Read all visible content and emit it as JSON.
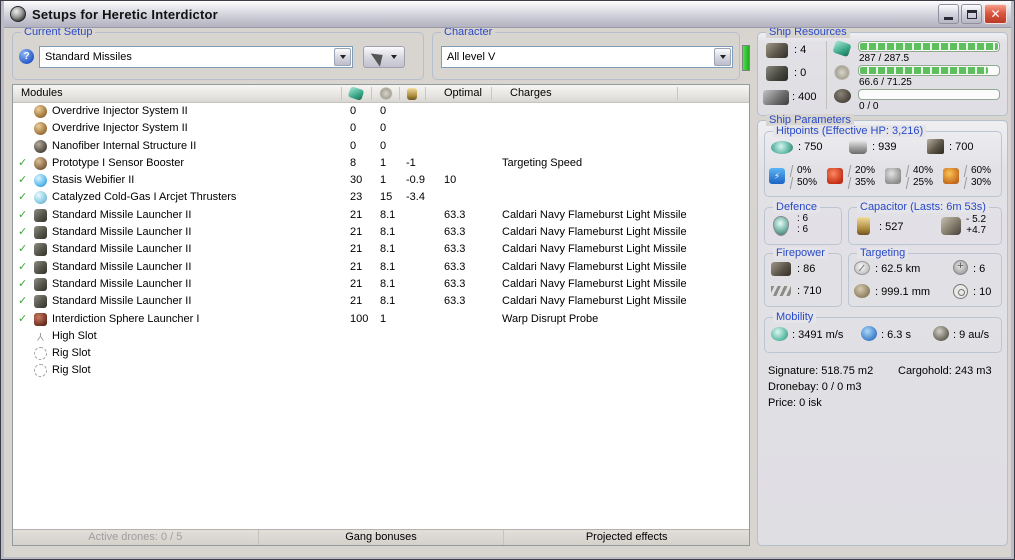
{
  "window": {
    "title": "Setups for Heretic Interdictor"
  },
  "current_setup": {
    "label": "Current Setup",
    "value": "Standard Missiles"
  },
  "character": {
    "label": "Character",
    "value": "All level V"
  },
  "ship_resources": {
    "label": "Ship Resources",
    "turrets": ": 4",
    "launchers": ": 0",
    "calibration": ": 400",
    "cpu_text": "287 / 287.5",
    "cpu_fill": 100,
    "pg_text": "66.6 / 71.25",
    "pg_fill": 93,
    "drone_text": "0 / 0",
    "drone_fill": 0
  },
  "modules_table": {
    "columns": {
      "modules": "Modules",
      "optimal": "Optimal",
      "charges": "Charges"
    },
    "rows": [
      {
        "active": false,
        "icon": "overdrive",
        "name": "Overdrive Injector System II",
        "cpu": "0",
        "pg": "0",
        "cap": "",
        "optimal": "",
        "charge": ""
      },
      {
        "active": false,
        "icon": "overdrive",
        "name": "Overdrive Injector System II",
        "cpu": "0",
        "pg": "0",
        "cap": "",
        "optimal": "",
        "charge": ""
      },
      {
        "active": false,
        "icon": "nanofiber",
        "name": "Nanofiber Internal Structure II",
        "cpu": "0",
        "pg": "0",
        "cap": "",
        "optimal": "",
        "charge": ""
      },
      {
        "active": true,
        "icon": "sensor-booster",
        "name": "Prototype I Sensor Booster",
        "cpu": "8",
        "pg": "1",
        "cap": "-1",
        "optimal": "",
        "charge": "Targeting Speed"
      },
      {
        "active": true,
        "icon": "webifier",
        "name": "Stasis Webifier II",
        "cpu": "30",
        "pg": "1",
        "cap": "-0.9",
        "optimal": "10",
        "charge": ""
      },
      {
        "active": true,
        "icon": "mwd",
        "name": "Catalyzed Cold-Gas I Arcjet Thrusters",
        "cpu": "23",
        "pg": "15",
        "cap": "-3.4",
        "optimal": "",
        "charge": ""
      },
      {
        "active": true,
        "icon": "missile-launcher",
        "name": "Standard Missile Launcher II",
        "cpu": "21",
        "pg": "8.1",
        "cap": "",
        "optimal": "63.3",
        "charge": "Caldari Navy Flameburst Light Missile"
      },
      {
        "active": true,
        "icon": "missile-launcher",
        "name": "Standard Missile Launcher II",
        "cpu": "21",
        "pg": "8.1",
        "cap": "",
        "optimal": "63.3",
        "charge": "Caldari Navy Flameburst Light Missile"
      },
      {
        "active": true,
        "icon": "missile-launcher",
        "name": "Standard Missile Launcher II",
        "cpu": "21",
        "pg": "8.1",
        "cap": "",
        "optimal": "63.3",
        "charge": "Caldari Navy Flameburst Light Missile"
      },
      {
        "active": true,
        "icon": "missile-launcher",
        "name": "Standard Missile Launcher II",
        "cpu": "21",
        "pg": "8.1",
        "cap": "",
        "optimal": "63.3",
        "charge": "Caldari Navy Flameburst Light Missile"
      },
      {
        "active": true,
        "icon": "missile-launcher",
        "name": "Standard Missile Launcher II",
        "cpu": "21",
        "pg": "8.1",
        "cap": "",
        "optimal": "63.3",
        "charge": "Caldari Navy Flameburst Light Missile"
      },
      {
        "active": true,
        "icon": "missile-launcher",
        "name": "Standard Missile Launcher II",
        "cpu": "21",
        "pg": "8.1",
        "cap": "",
        "optimal": "63.3",
        "charge": "Caldari Navy Flameburst Light Missile"
      },
      {
        "active": true,
        "icon": "interdiction",
        "name": "Interdiction Sphere Launcher I",
        "cpu": "100",
        "pg": "1",
        "cap": "",
        "optimal": "",
        "charge": "Warp Disrupt Probe"
      },
      {
        "active": false,
        "icon": "high-slot",
        "name": "High Slot",
        "cpu": "",
        "pg": "",
        "cap": "",
        "optimal": "",
        "charge": ""
      },
      {
        "active": false,
        "icon": "rig-slot",
        "name": "Rig Slot",
        "cpu": "",
        "pg": "",
        "cap": "",
        "optimal": "",
        "charge": ""
      },
      {
        "active": false,
        "icon": "rig-slot",
        "name": "Rig Slot",
        "cpu": "",
        "pg": "",
        "cap": "",
        "optimal": "",
        "charge": ""
      }
    ],
    "footer": {
      "active_drones": "Active drones: 0 / 5",
      "gang_bonuses": "Gang bonuses",
      "projected_effects": "Projected effects"
    }
  },
  "ship_parameters": {
    "label": "Ship Parameters",
    "hitpoints": {
      "label": "Hitpoints (Effective HP: 3,216)",
      "shield": ": 750",
      "armor": ": 939",
      "structure": ": 700",
      "resists": [
        {
          "name": "em",
          "shield": "0%",
          "armor": "50%"
        },
        {
          "name": "thermal",
          "shield": "20%",
          "armor": "35%"
        },
        {
          "name": "kinetic",
          "shield": "40%",
          "armor": "25%"
        },
        {
          "name": "explosive",
          "shield": "60%",
          "armor": "30%"
        }
      ]
    },
    "defence": {
      "label": "Defence",
      "v1": ": 6",
      "v2": ": 6"
    },
    "capacitor": {
      "label": "Capacitor (Lasts: 6m 53s)",
      "amount": ": 527",
      "delta_neg": "- 5.2",
      "delta_pos": "+4.7"
    },
    "firepower": {
      "label": "Firepower",
      "volley": ": 86",
      "dps": ": 710"
    },
    "targeting": {
      "label": "Targeting",
      "range": ": 62.5 km",
      "scan_res": ": 999.1 mm",
      "max_targets": ": 6",
      "sensor_strength": ": 10"
    },
    "mobility": {
      "label": "Mobility",
      "speed": ": 3491 m/s",
      "agility": ": 6.3 s",
      "warp": ": 9 au/s"
    },
    "stats": {
      "signature": "Signature: 518.75 m2",
      "cargohold": "Cargohold: 243 m3",
      "dronebay": "Dronebay: 0 / 0 m3",
      "price": "Price: 0 isk"
    }
  },
  "icons": {
    "help-icon": "?",
    "close-icon": "✕",
    "check-icon": "✓",
    "em-resist-icon": "⚡"
  },
  "colors": {
    "groupbox_label_blue": "#2849c8",
    "check_green": "#3aa63a",
    "bar_green": "#5fbf5f",
    "close_red": "#dd5740",
    "indicator_green": "#1fae1f",
    "window_bg": "#d8d4cf"
  }
}
